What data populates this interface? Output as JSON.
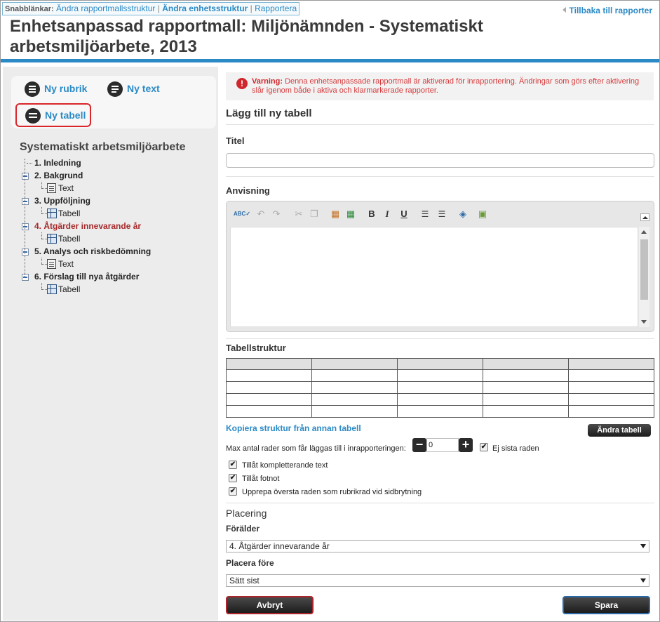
{
  "quicklinks": {
    "label": "Snabblänkar:",
    "links": [
      "Ändra rapportmallsstruktur",
      "Ändra enhetsstruktur",
      "Rapportera"
    ],
    "separator": "|"
  },
  "back_link": "Tillbaka till rapporter",
  "page_title": "Enhetsanpassad rapportmall: Miljönämnden - Systematiskt arbetsmiljöarbete, 2013",
  "tools": {
    "new_heading": "Ny rubrik",
    "new_text": "Ny text",
    "new_table": "Ny tabell"
  },
  "tree": {
    "title": "Systematiskt arbetsmiljöarbete",
    "items": [
      {
        "label": "1. Inledning"
      },
      {
        "label": "2. Bakgrund"
      },
      {
        "label": "Text"
      },
      {
        "label": "3. Uppföljning"
      },
      {
        "label": "Tabell"
      },
      {
        "label": "4. Åtgärder innevarande år"
      },
      {
        "label": "Tabell"
      },
      {
        "label": "5. Analys och riskbedömning"
      },
      {
        "label": "Text"
      },
      {
        "label": "6. Förslag till nya åtgärder"
      },
      {
        "label": "Tabell"
      }
    ]
  },
  "warning": {
    "prefix": "Varning:",
    "text": "Denna enhetsanpassade rapportmall är aktiverad för inrapportering. Ändringar som görs efter aktivering slår igenom både i aktiva och klarmarkerade rapporter."
  },
  "form": {
    "heading": "Lägg till ny tabell",
    "title_label": "Titel",
    "title_value": "",
    "guidance_label": "Anvisning",
    "structure_label": "Tabellstruktur",
    "copy_link": "Kopiera struktur från annan tabell",
    "change_table_button": "Ändra tabell",
    "max_rows_label": "Max antal rader som får läggas till i inrapporteringen:",
    "max_rows_value": "0",
    "not_last_row_label": "Ej sista raden",
    "allow_extra_text": "Tillåt kompletterande text",
    "allow_footnote": "Tillåt fotnot",
    "repeat_header": "Upprepa översta raden som rubrikrad vid sidbrytning",
    "placement_heading": "Placering",
    "parent_label": "Förälder",
    "parent_value": "4. Åtgärder innevarande år",
    "place_before_label": "Placera före",
    "place_before_value": "Sätt sist",
    "cancel_button": "Avbryt",
    "save_button": "Spara"
  },
  "colors": {
    "accent": "#2b8ac6",
    "warning": "#d0272c",
    "selected_outline": "#d9262b"
  }
}
